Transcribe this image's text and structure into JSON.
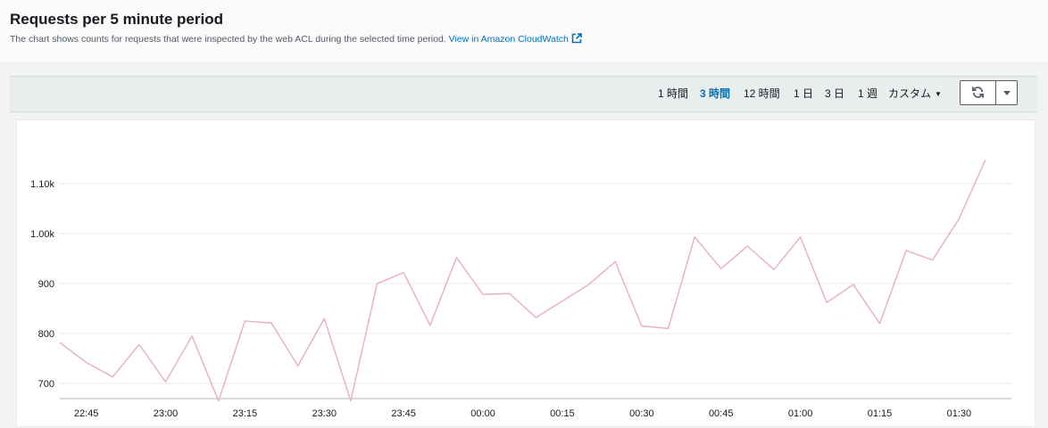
{
  "header": {
    "title": "Requests per 5 minute period",
    "subtitle": "The chart shows counts for requests that were inspected by the web ACL during the selected time period.",
    "link_label": "View in Amazon CloudWatch",
    "link_icon": "external-link-icon"
  },
  "toolbar": {
    "ranges": [
      {
        "label": "1 時間",
        "active": false
      },
      {
        "label": "3 時間",
        "active": true
      },
      {
        "label": "12 時間",
        "active": false
      },
      {
        "label": "1 日",
        "active": false
      },
      {
        "label": "3 日",
        "active": false
      },
      {
        "label": "1 週",
        "active": false
      }
    ],
    "custom_label": "カスタム",
    "refresh_icon": "refresh-icon",
    "dropdown_icon": "caret-down-icon"
  },
  "chart_data": {
    "type": "line",
    "title": "",
    "xlabel": "",
    "ylabel": "",
    "x": [
      "22:40",
      "22:45",
      "22:50",
      "22:55",
      "23:00",
      "23:05",
      "23:10",
      "23:15",
      "23:20",
      "23:25",
      "23:30",
      "23:35",
      "23:40",
      "23:45",
      "23:50",
      "23:55",
      "00:00",
      "00:05",
      "00:10",
      "00:15",
      "00:20",
      "00:25",
      "00:30",
      "00:35",
      "00:40",
      "00:45",
      "00:50",
      "00:55",
      "01:00",
      "01:05",
      "01:10",
      "01:15",
      "01:20",
      "01:25",
      "01:30",
      "01:35"
    ],
    "x_ticks": [
      "22:45",
      "23:00",
      "23:15",
      "23:30",
      "23:45",
      "00:00",
      "00:15",
      "00:30",
      "00:45",
      "01:00",
      "01:15",
      "01:30"
    ],
    "y_ticks": [
      {
        "value": 700,
        "label": "700"
      },
      {
        "value": 800,
        "label": "800"
      },
      {
        "value": 900,
        "label": "900"
      },
      {
        "value": 1000,
        "label": "1.00k"
      },
      {
        "value": 1100,
        "label": "1.10k"
      }
    ],
    "ylim": [
      660,
      1150
    ],
    "series": [
      {
        "color": "#e8b4c0",
        "values": [
          782,
          742,
          713,
          778,
          703,
          795,
          665,
          825,
          821,
          735,
          830,
          665,
          900,
          922,
          816,
          952,
          878,
          880,
          832,
          865,
          898,
          944,
          815,
          810,
          993,
          930,
          975,
          928,
          993,
          862,
          898,
          820,
          966,
          947,
          1030,
          1148
        ]
      }
    ],
    "grid": true
  }
}
